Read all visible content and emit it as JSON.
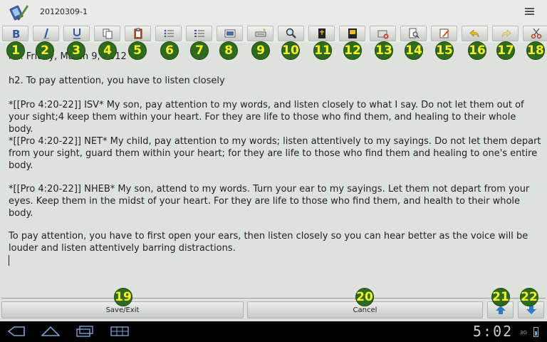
{
  "window": {
    "title": "20120309-1"
  },
  "toolbar": {
    "buttons": [
      {
        "icon": "bold-icon",
        "num": "1"
      },
      {
        "icon": "italic-icon",
        "num": "2"
      },
      {
        "icon": "underline-icon",
        "num": "3"
      },
      {
        "icon": "copy-icon",
        "num": "4"
      },
      {
        "icon": "paste-icon",
        "num": "5"
      },
      {
        "icon": "bullet-list-icon",
        "num": "6"
      },
      {
        "icon": "numbered-list-icon",
        "num": "7"
      },
      {
        "icon": "image-icon",
        "num": "8"
      },
      {
        "icon": "link-icon",
        "num": "9"
      },
      {
        "icon": "search-icon",
        "num": "10"
      },
      {
        "icon": "bible-icon",
        "num": "11"
      },
      {
        "icon": "save-icon",
        "num": "12"
      },
      {
        "icon": "delete-note-icon",
        "num": "13"
      },
      {
        "icon": "preview-icon",
        "num": "14"
      },
      {
        "icon": "edit-icon",
        "num": "15"
      },
      {
        "icon": "undo-icon",
        "num": "16"
      },
      {
        "icon": "redo-icon",
        "num": "17"
      },
      {
        "icon": "cut-icon",
        "num": "18"
      }
    ]
  },
  "editor": {
    "lines": [
      "h1. Friday, March 9, 2012",
      "h2. To pay attention, you have to listen closely",
      "*[[Pro 4:20-22]] ISV* My son, pay attention to my words, and listen closely to what I say. Do not let them out of your sight;4 keep them within your heart. For they are life to those who find them, and healing to their whole body.",
      "*[[Pro 4:20-22]] NET* My child, pay attention to my words; listen attentively to my sayings. Do not let them depart from your sight, guard them within your heart; for they are life to those who find them and healing to one's entire body.",
      "*[[Pro 4:20-22]] NHEB* My son, attend to my words. Turn your ear to my sayings. Let them not depart from your eyes. Keep them in the midst of your heart. For they are life to those who find them, and health to their whole body.",
      "To pay attention, you have to first open your ears, then listen closely so you can hear better as the voice will be louder and listen attentively barring distractions."
    ]
  },
  "bottom": {
    "save_label": "Save/Exit",
    "cancel_label": "Cancel",
    "badges": [
      "19",
      "20",
      "21",
      "22"
    ]
  },
  "status": {
    "time": "5:02",
    "signal": "3G"
  },
  "colors": {
    "badge_bg": "#2f6b1e",
    "badge_text": "#f7ef2a"
  }
}
